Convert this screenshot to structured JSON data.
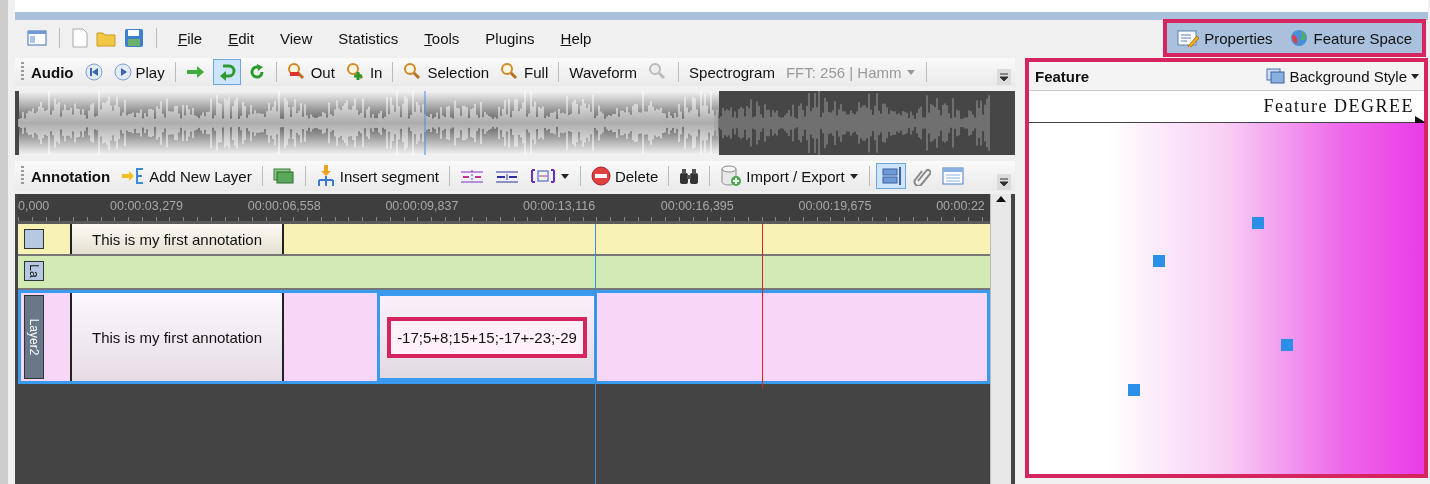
{
  "menu": [
    {
      "label": "File",
      "mnemonic": true
    },
    {
      "label": "Edit",
      "mnemonic": true
    },
    {
      "label": "View",
      "mnemonic": false
    },
    {
      "label": "Statistics",
      "mnemonic": false
    },
    {
      "label": "Tools",
      "mnemonic": true
    },
    {
      "label": "Plugins",
      "mnemonic": false
    },
    {
      "label": "Help",
      "mnemonic": true
    }
  ],
  "panel_tabs": [
    {
      "label": "Properties"
    },
    {
      "label": "Feature Space"
    }
  ],
  "audio_toolbar": {
    "title": "Audio",
    "play": "Play",
    "loop_pressed": true,
    "zoom_out": "Out",
    "zoom_in": "In",
    "zoom_selection": "Selection",
    "zoom_full": "Full",
    "waveform": "Waveform",
    "waveform_zoom_disabled": true,
    "spectrogram": "Spectrogram",
    "fft": {
      "value": "FFT: 256 | Hamm",
      "disabled": true
    }
  },
  "annotation_toolbar": {
    "title": "Annotation",
    "add_layer": "Add New Layer",
    "insert_segment": "Insert segment",
    "delete": "Delete",
    "import_export": "Import / Export",
    "layout_pressed": true
  },
  "ruler": {
    "ticks": [
      "0,000",
      "00:00:03,279",
      "00:00:06,558",
      "00:00:09,837",
      "00:00:13,116",
      "00:00:16,395",
      "00:00:19,675",
      "00:00:22"
    ]
  },
  "tracks": [
    {
      "color": "#f8f2b4",
      "selected": false,
      "segments": [
        {
          "text": "This is my first annotation",
          "selected": false
        }
      ]
    },
    {
      "color": "#d2eab4",
      "selected": false,
      "label": "La"
    },
    {
      "color": "#f8d6f8",
      "selected": true,
      "label": "Layer2",
      "segments": [
        {
          "text": "This is my first annotation",
          "selected": false
        },
        {
          "text": "-17;5+8;15+15;-17+-23;-29",
          "selected": true
        }
      ]
    }
  ],
  "feature_panel": {
    "title": "Feature",
    "background_style": "Background Style",
    "axis_label": "Feature DEGREE"
  }
}
